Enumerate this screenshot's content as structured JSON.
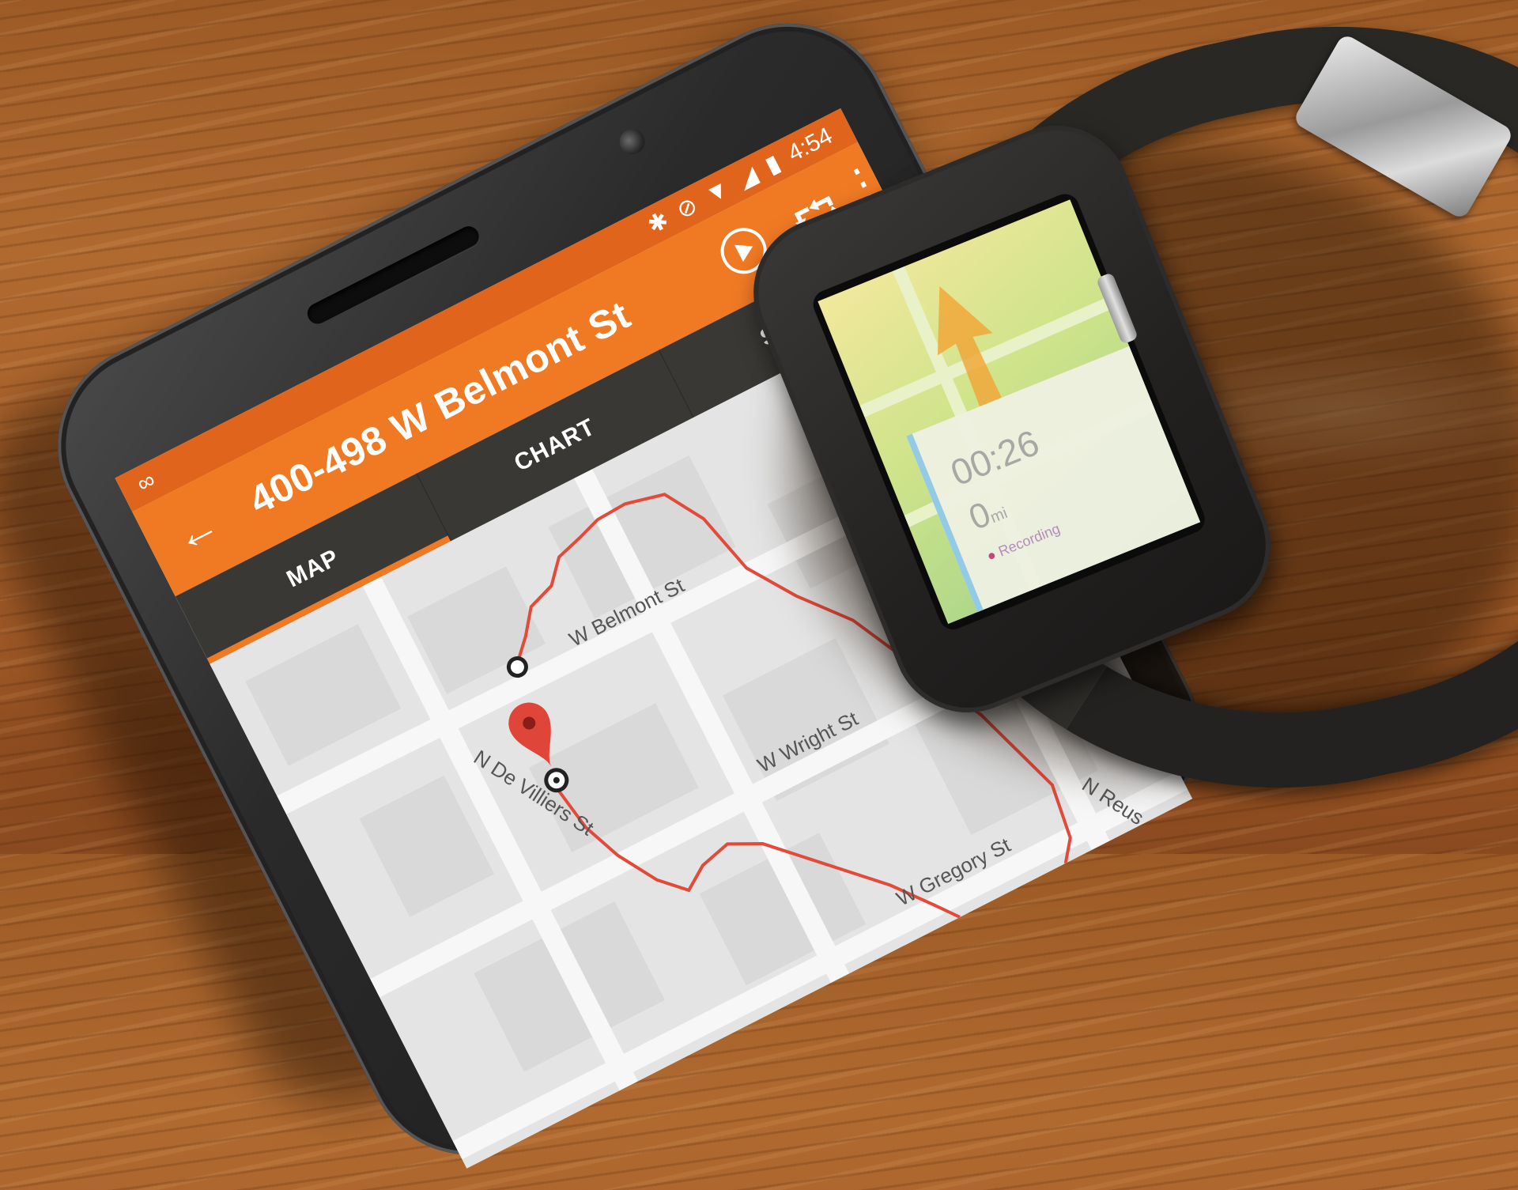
{
  "status_bar": {
    "icons": [
      "voicemail-icon",
      "bluetooth-icon",
      "do-not-disturb-icon",
      "wifi-icon",
      "signal-icon",
      "battery-icon"
    ],
    "time": "4:54"
  },
  "toolbar": {
    "back_icon": "arrow-left-icon",
    "title": "400-498 W Belmont St",
    "actions": [
      "play-icon",
      "share-icon",
      "more-vert-icon"
    ]
  },
  "tabs": [
    {
      "label": "MAP",
      "active": true
    },
    {
      "label": "CHART",
      "active": false
    },
    {
      "label": "STATS",
      "active": false
    }
  ],
  "map": {
    "streets": [
      "W Belmont St",
      "N De Villiers St",
      "W Wright St",
      "W Gregory St",
      "N Reus St"
    ],
    "locate_icon": "my-location-icon",
    "markers": [
      "start-marker-icon",
      "end-pin-icon"
    ]
  },
  "watch": {
    "elapsed": "00:26",
    "distance": "0",
    "distance_unit": "mi",
    "status": "Recording"
  },
  "colors": {
    "toolbar": "#f07a24",
    "status_bar": "#e0641c",
    "tabs_bg": "#3a3834",
    "route": "#e24a3a"
  }
}
